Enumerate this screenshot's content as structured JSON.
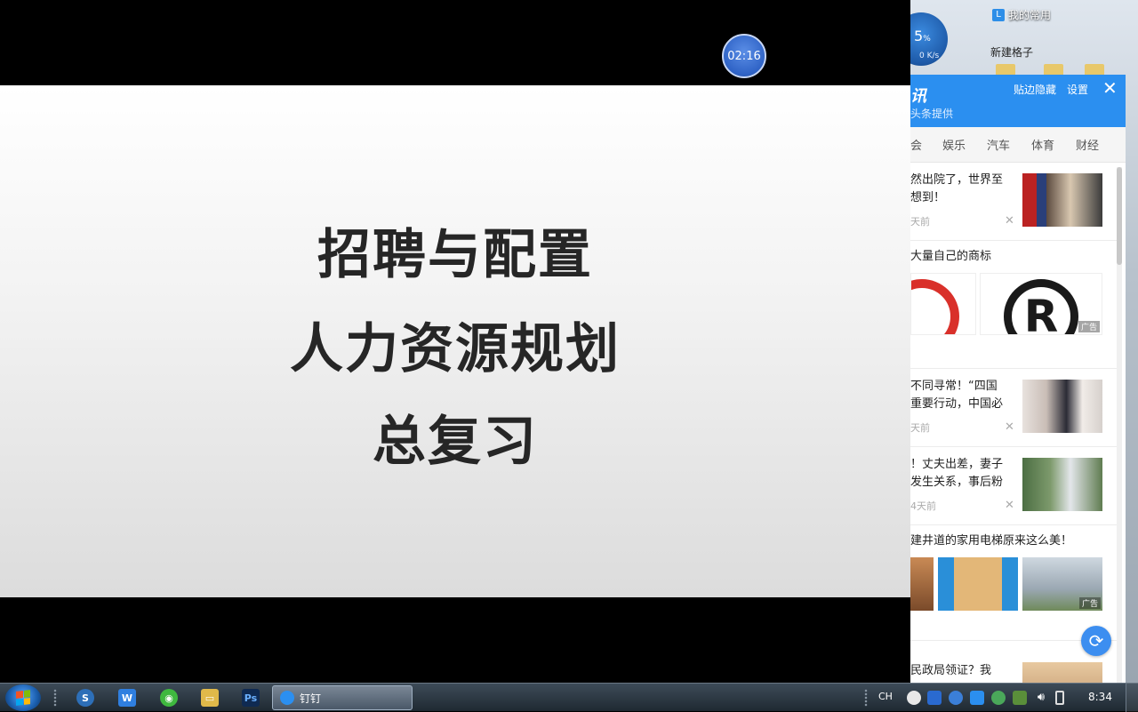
{
  "presentation": {
    "slide_lines": [
      "招聘与配置",
      "人力资源规划",
      "总复习"
    ],
    "timer": "02:16"
  },
  "desktop": {
    "speed_percent": "5",
    "speed_percent_unit": "%",
    "speed_rate": "0 K/s",
    "favorites_label": "我的常用",
    "new_grid_label": "新建格子"
  },
  "news_panel": {
    "brand": "讯",
    "provider": "头条提供",
    "hide_label": "贴边隐藏",
    "settings_label": "设置",
    "tabs": [
      "会",
      "娱乐",
      "汽车",
      "体育",
      "财经"
    ],
    "items": [
      {
        "title_line1": "然出院了，世界至",
        "title_line2": "想到！",
        "time": "天前"
      },
      {
        "title": "大量自己的商标",
        "ad_label": "广告"
      },
      {
        "title_line1": "不同寻常！“四国",
        "title_line2": "重要行动，中国必",
        "time": "天前"
      },
      {
        "title_line1": "！丈夫出差，妻子",
        "title_line2": "发生关系，事后粉",
        "time": "4天前"
      },
      {
        "title": "建井道的家用电梯原来这么美！",
        "ad_label": "广告"
      },
      {
        "title": "民政局领证？我"
      }
    ]
  },
  "taskbar": {
    "active_task_label": "钉钉",
    "language": "CH",
    "clock": "8:34"
  }
}
